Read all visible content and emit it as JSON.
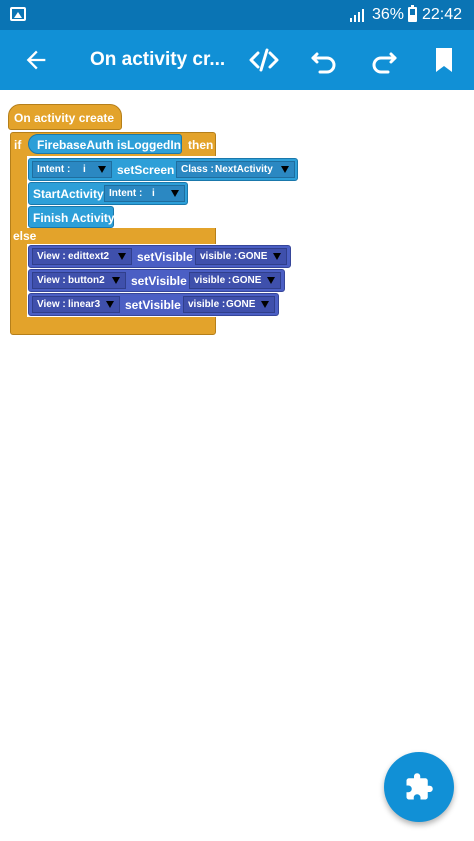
{
  "status_bar": {
    "battery_percent": "36%",
    "time": "22:42",
    "icons": [
      "gallery-icon",
      "signal-icon",
      "battery-icon"
    ]
  },
  "toolbar": {
    "title": "On activity cr...",
    "icons": [
      "arrow-back-icon",
      "code-icon",
      "undo-icon",
      "redo-icon",
      "bookmark-icon"
    ]
  },
  "blocks": {
    "event": "On activity create",
    "if_label": "if",
    "condition": "FirebaseAuth isLoggedIn",
    "then_label": "then",
    "set_screen": {
      "intent_key": "Intent :",
      "intent_value": "i",
      "action": "setScreen",
      "class_key": "Class :",
      "class_value": "NextActivity"
    },
    "start_activity": {
      "action": "StartActivity",
      "intent_key": "Intent :",
      "intent_value": "i"
    },
    "finish": "Finish Activity",
    "else_label": "else",
    "set_visible": [
      {
        "view_key": "View :",
        "view_value": "edittext2",
        "action": "setVisible",
        "vis_key": "visible :",
        "vis_value": "GONE"
      },
      {
        "view_key": "View :",
        "view_value": "button2",
        "action": "setVisible",
        "vis_key": "visible :",
        "vis_value": "GONE"
      },
      {
        "view_key": "View :",
        "view_value": "linear3",
        "action": "setVisible",
        "vis_key": "visible :",
        "vis_value": "GONE"
      }
    ]
  },
  "fab": {
    "icon": "puzzle-icon"
  },
  "colors": {
    "status_bar": "#0a74b4",
    "toolbar": "#1190d6",
    "event_block": "#e3a32b",
    "intent_block": "#2d9fd8",
    "view_block": "#4b5fc4"
  }
}
